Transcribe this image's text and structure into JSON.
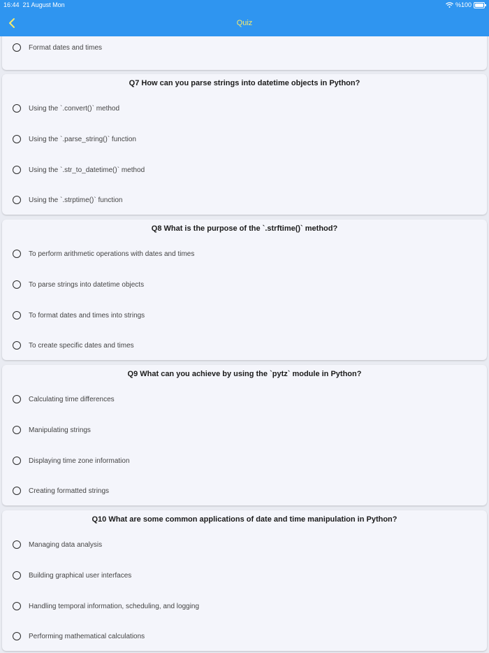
{
  "status_bar": {
    "time": "16:44",
    "date": "21 August Mon",
    "battery_text": "%100"
  },
  "header": {
    "title": "Quiz",
    "back_icon": "chevron-left-icon",
    "background_color": "#2f95f0",
    "title_color": "#f5ea6e"
  },
  "questions": [
    {
      "title": "",
      "options": [
        "Format dates and times"
      ]
    },
    {
      "title": "Q7 How can you parse strings into datetime objects in Python?",
      "options": [
        "Using the `.convert()` method",
        "Using the `.parse_string()` function",
        "Using the `.str_to_datetime()` method",
        "Using the `.strptime()` function"
      ]
    },
    {
      "title": "Q8 What is the purpose of the `.strftime()` method?",
      "options": [
        "To perform arithmetic operations with dates and times",
        "To parse strings into datetime objects",
        "To format dates and times into strings",
        "To create specific dates and times"
      ]
    },
    {
      "title": "Q9 What can you achieve by using the `pytz` module in Python?",
      "options": [
        "Calculating time differences",
        "Manipulating strings",
        "Displaying time zone information",
        "Creating formatted strings"
      ]
    },
    {
      "title": "Q10 What are some common applications of date and time manipulation in Python?",
      "options": [
        "Managing data analysis",
        "Building graphical user interfaces",
        "Handling temporal information, scheduling, and logging",
        "Performing mathematical calculations"
      ]
    }
  ]
}
